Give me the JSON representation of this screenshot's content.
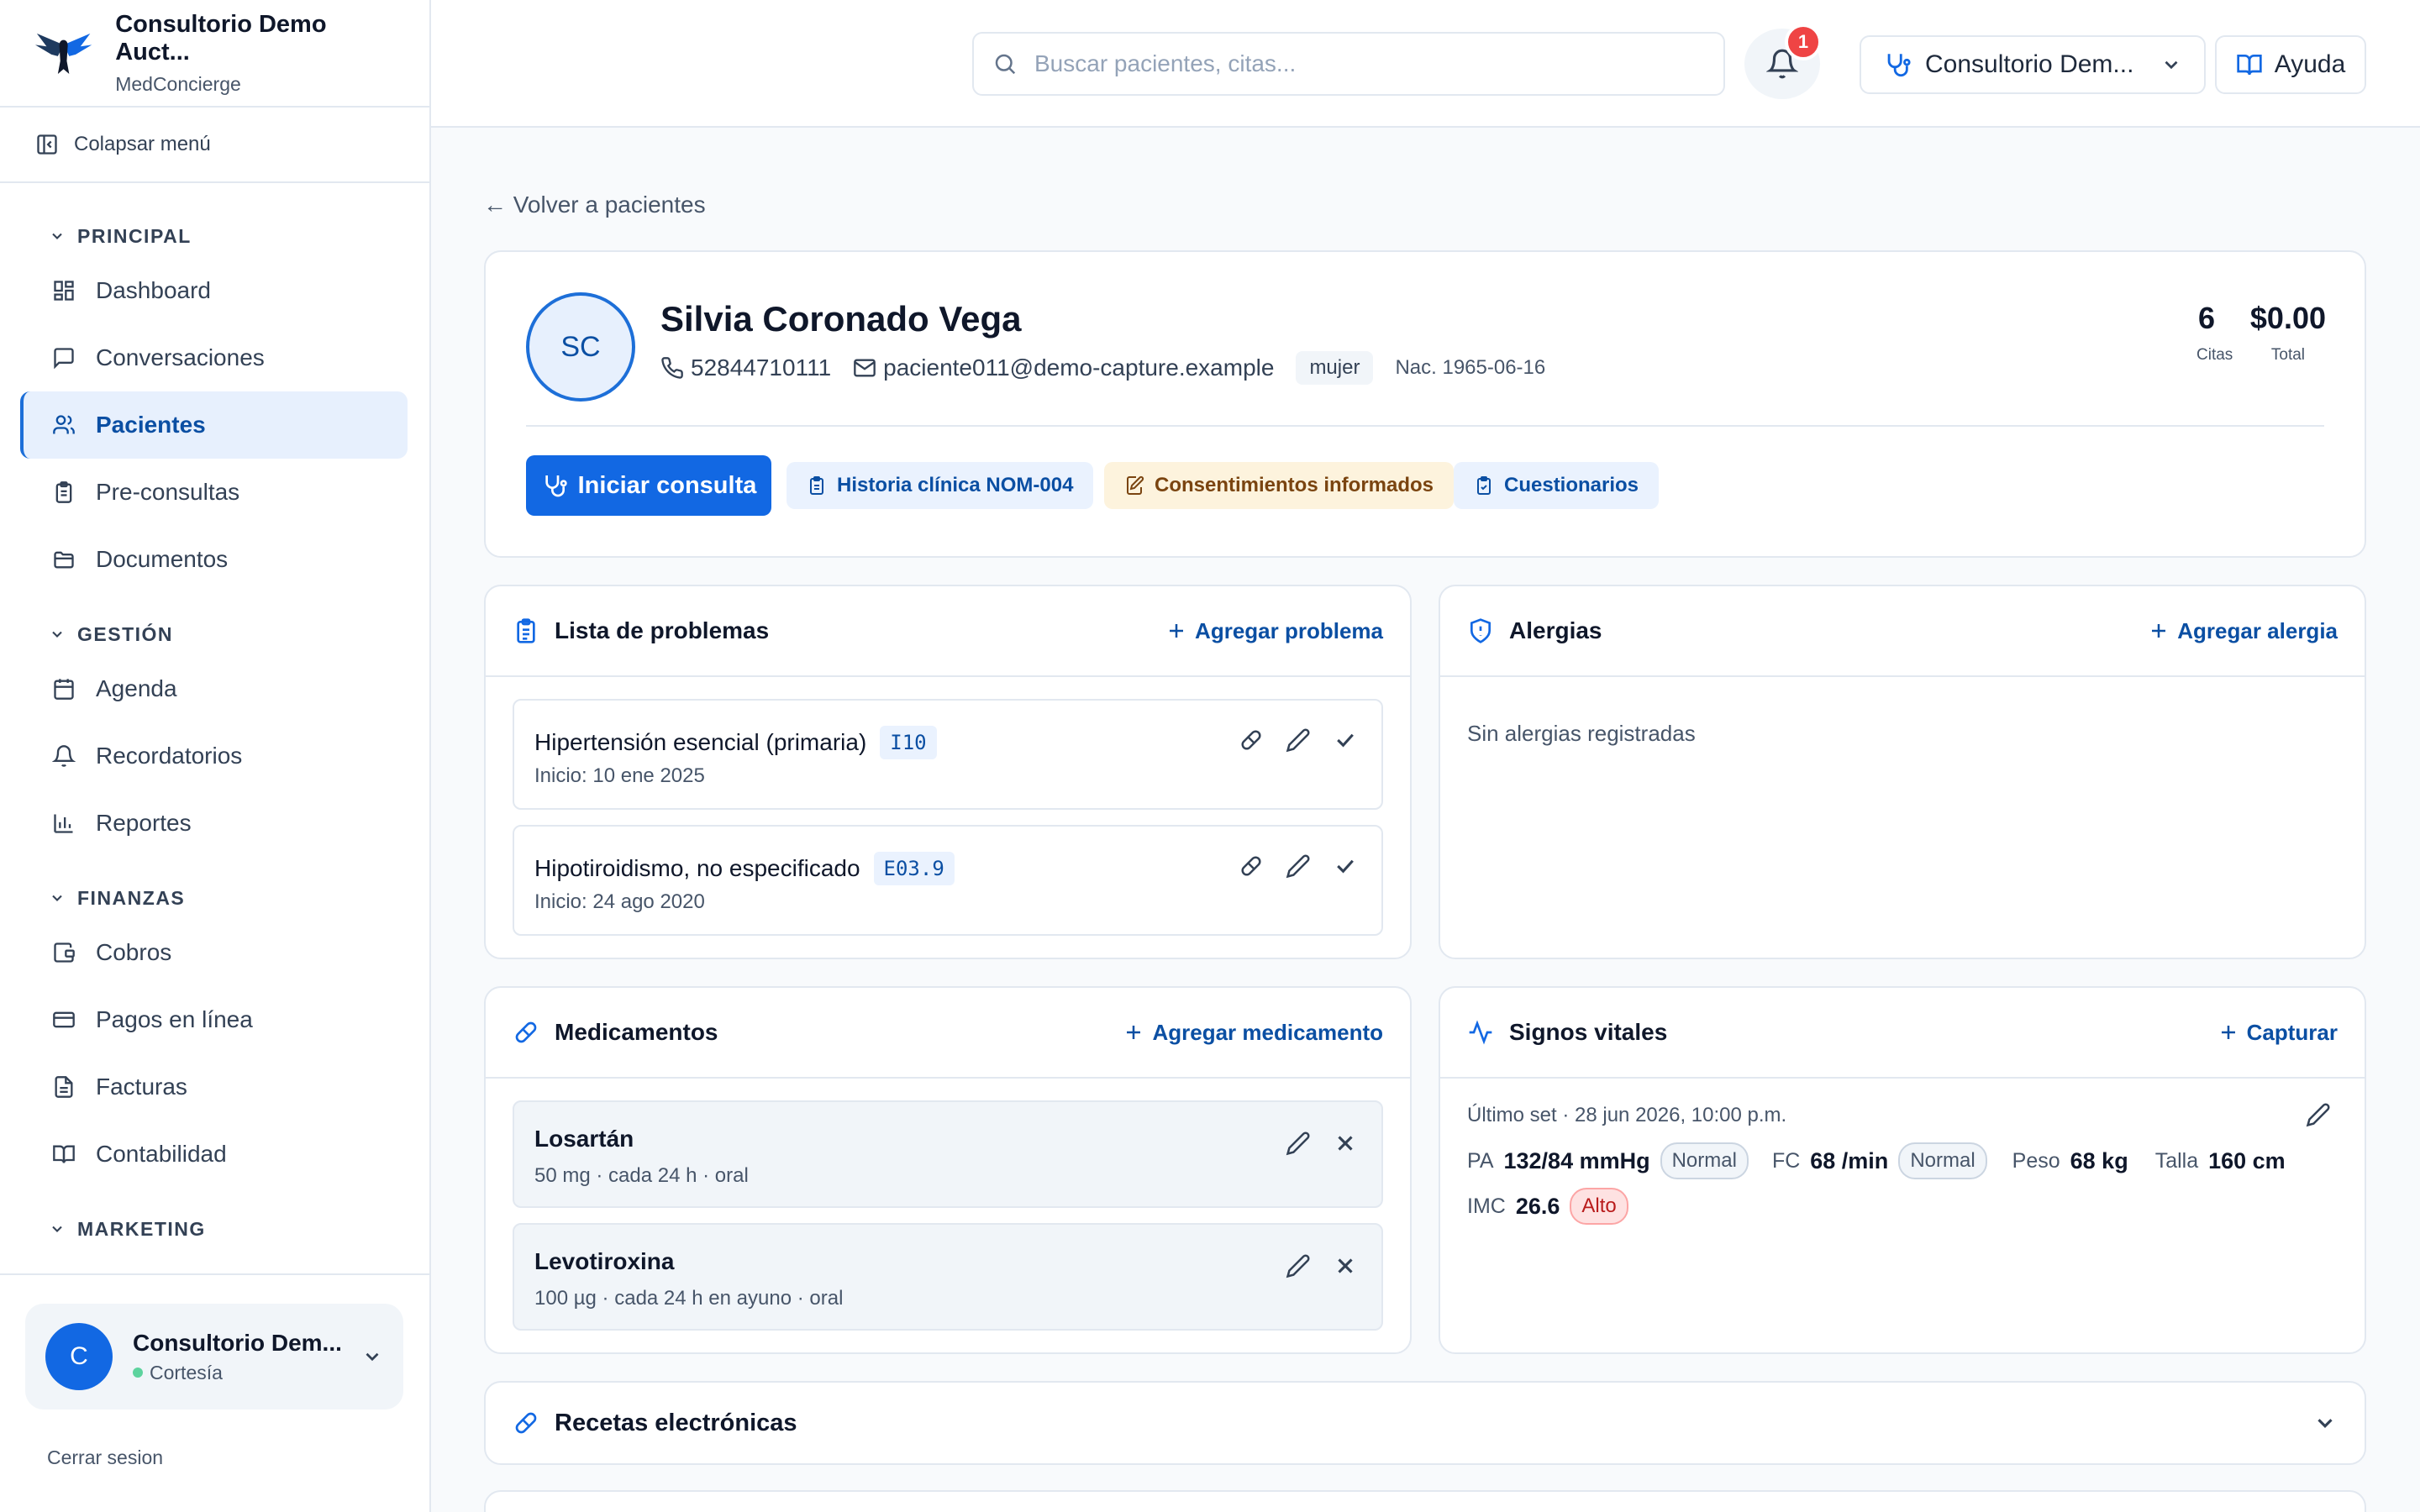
{
  "app": {
    "name": "Consultorio Demo Auct...",
    "product": "MedConcierge"
  },
  "sidebar": {
    "collapse_label": "Colapsar menú",
    "sections": [
      {
        "label": "PRINCIPAL"
      },
      {
        "label": "GESTIÓN"
      },
      {
        "label": "FINANZAS"
      },
      {
        "label": "MARKETING"
      }
    ],
    "items": [
      {
        "label": "Dashboard",
        "icon": "dashboard-icon"
      },
      {
        "label": "Conversaciones",
        "icon": "chat-icon"
      },
      {
        "label": "Pacientes",
        "icon": "users-icon",
        "active": true
      },
      {
        "label": "Pre-consultas",
        "icon": "clipboard-icon"
      },
      {
        "label": "Documentos",
        "icon": "folder-icon"
      },
      {
        "label": "Agenda",
        "icon": "calendar-icon"
      },
      {
        "label": "Recordatorios",
        "icon": "bell-icon"
      },
      {
        "label": "Reportes",
        "icon": "bar-chart-icon"
      },
      {
        "label": "Cobros",
        "icon": "wallet-icon"
      },
      {
        "label": "Pagos en línea",
        "icon": "credit-card-icon"
      },
      {
        "label": "Facturas",
        "icon": "invoice-icon"
      },
      {
        "label": "Contabilidad",
        "icon": "book-icon"
      }
    ],
    "user": {
      "initial": "C",
      "name": "Consultorio Dem...",
      "plan": "Cortesía"
    },
    "logout_label": "Cerrar sesion"
  },
  "topbar": {
    "search_placeholder": "Buscar pacientes, citas...",
    "notifications_count": "1",
    "clinic_label": "Consultorio Dem...",
    "help_label": "Ayuda"
  },
  "back_label": "← Volver a pacientes",
  "patient": {
    "initials": "SC",
    "name": "Silvia Coronado Vega",
    "phone": "52844710111",
    "email": "paciente011@demo-capture.example",
    "sex": "mujer",
    "dob": "Nac. 1965-06-16",
    "stats": [
      {
        "value": "6",
        "label": "Citas"
      },
      {
        "value": "$0.00",
        "label": "Total"
      }
    ],
    "actions": {
      "start": "Iniciar consulta",
      "history": "Historia clínica NOM-004",
      "consents": "Consentimientos informados",
      "questionnaires": "Cuestionarios"
    }
  },
  "problems": {
    "title": "Lista de problemas",
    "add_label": "Agregar problema",
    "items": [
      {
        "name": "Hipertensión esencial (primaria)",
        "code": "I10",
        "since": "Inicio: 10 ene 2025"
      },
      {
        "name": "Hipotiroidismo, no especificado",
        "code": "E03.9",
        "since": "Inicio: 24 ago 2020"
      }
    ]
  },
  "allergies": {
    "title": "Alergias",
    "add_label": "Agregar alergia",
    "empty": "Sin alergias registradas"
  },
  "medications": {
    "title": "Medicamentos",
    "add_label": "Agregar medicamento",
    "items": [
      {
        "name": "Losartán",
        "detail": "50 mg · cada 24 h · oral"
      },
      {
        "name": "Levotiroxina",
        "detail": "100 µg · cada 24 h en ayuno · oral"
      }
    ]
  },
  "vitals": {
    "title": "Signos vitales",
    "add_label": "Capturar",
    "last_set": "Último set · 28 jun 2026, 10:00 p.m.",
    "pa": {
      "label": "PA",
      "value": "132/84 mmHg",
      "status": "Normal"
    },
    "fc": {
      "label": "FC",
      "value": "68 /min",
      "status": "Normal"
    },
    "peso": {
      "label": "Peso",
      "value": "68 kg"
    },
    "talla": {
      "label": "Talla",
      "value": "160 cm"
    },
    "imc": {
      "label": "IMC",
      "value": "26.6",
      "status": "Alto"
    }
  },
  "prescriptions": {
    "title": "Recetas electrónicas"
  },
  "colors": {
    "accent": "#1268e3",
    "accent_dark": "#0b4fa3",
    "alert": "#ef4444"
  }
}
